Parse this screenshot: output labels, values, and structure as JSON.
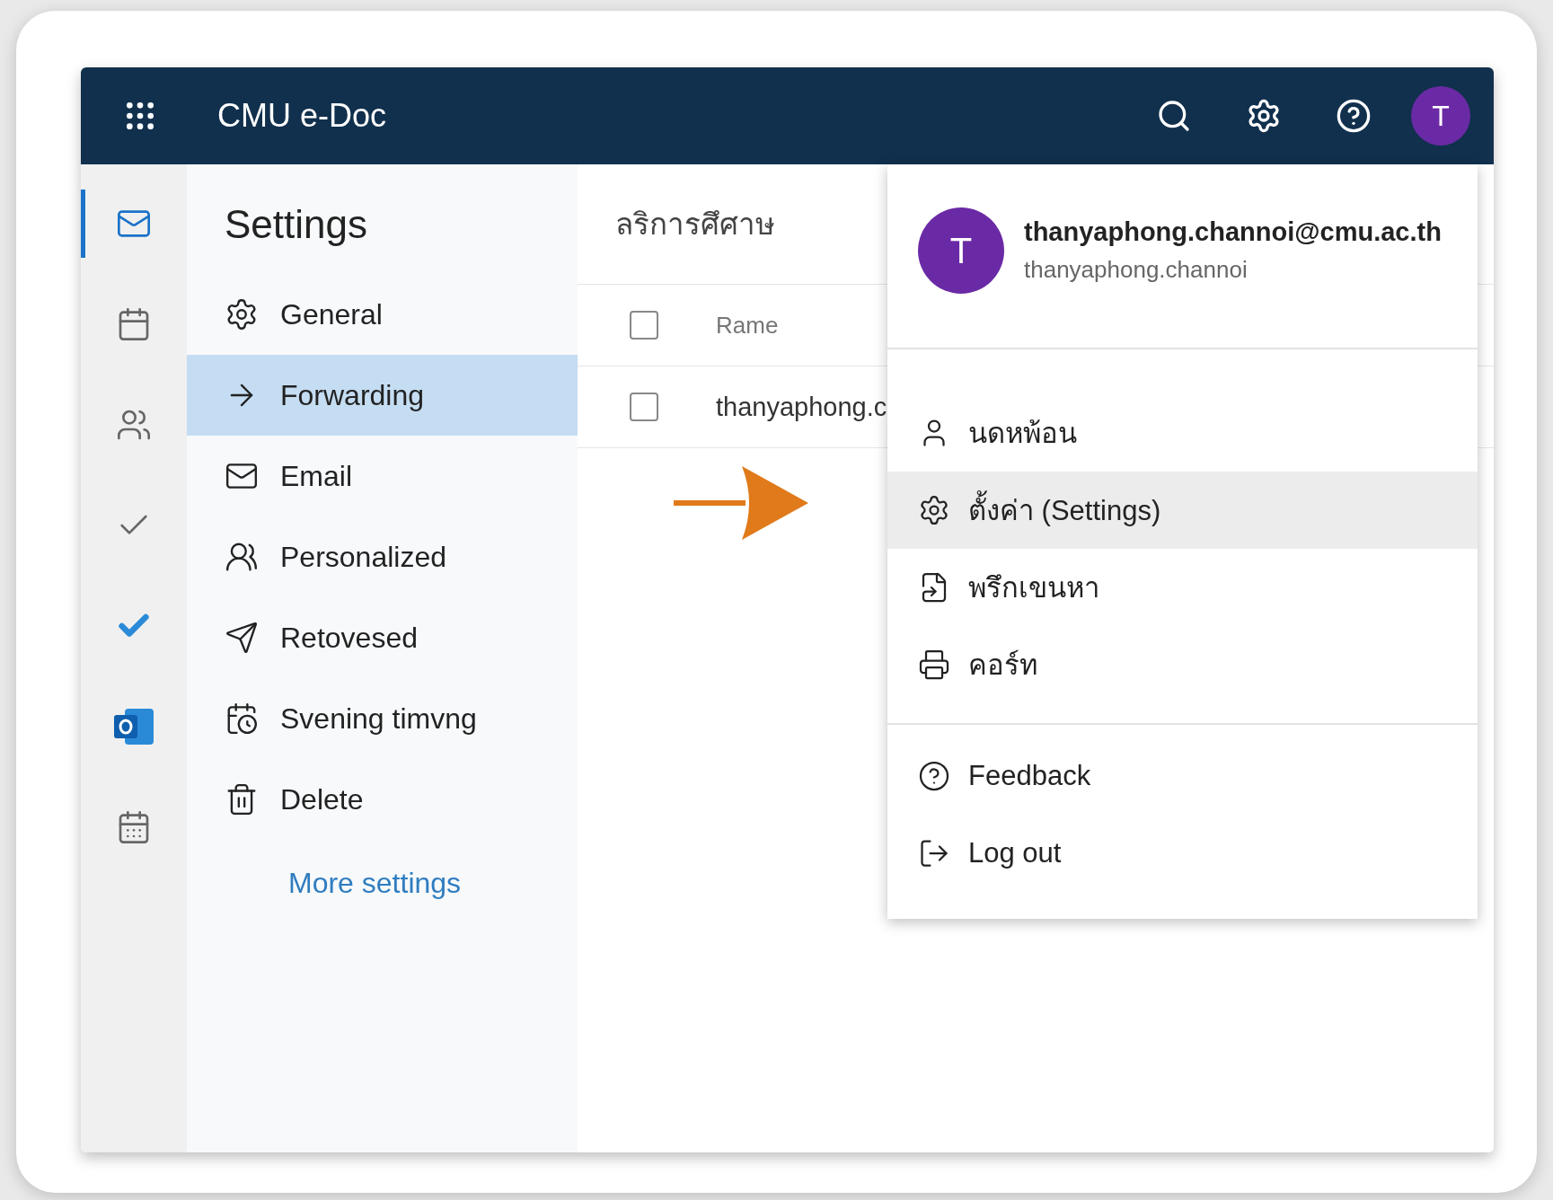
{
  "top_bar": {
    "app_title": "CMU e-Doc",
    "avatar_letter": "T"
  },
  "rail": [
    {
      "selected": true
    },
    {
      "selected": false
    },
    {
      "selected": false
    },
    {
      "selected": false
    },
    {
      "selected": false
    },
    {
      "selected": false
    },
    {
      "selected": false
    }
  ],
  "settings": {
    "title": "Settings",
    "items": [
      {
        "label": "General",
        "selected": false
      },
      {
        "label": "Forwarding",
        "selected": true
      },
      {
        "label": "Email",
        "selected": false
      },
      {
        "label": "Personalized",
        "selected": false
      },
      {
        "label": "Retovesed",
        "selected": false
      },
      {
        "label": "Svening timvng",
        "selected": false
      },
      {
        "label": "Delete",
        "selected": false
      }
    ],
    "more_link": "More settings"
  },
  "list": {
    "title": "ลริการศึศาษ",
    "header": {
      "label": "Rame",
      "checked": false
    },
    "rows": [
      {
        "text": "thanyaphong.c",
        "checked": false
      }
    ]
  },
  "account_menu": {
    "avatar_letter": "T",
    "email": "thanyaphong.channoi@cmu.ac.th",
    "username": "thanyaphong.channoi",
    "items": [
      {
        "label": "นดหพ้อน",
        "selected": false
      },
      {
        "label": "ตั้งค่า (Settings)",
        "selected": true
      },
      {
        "label": "พรึกเขนหา",
        "selected": false
      },
      {
        "label": "คอร์ท",
        "selected": false
      }
    ],
    "footer_items": [
      {
        "label": "Feedback"
      },
      {
        "label": "Log out"
      }
    ]
  }
}
